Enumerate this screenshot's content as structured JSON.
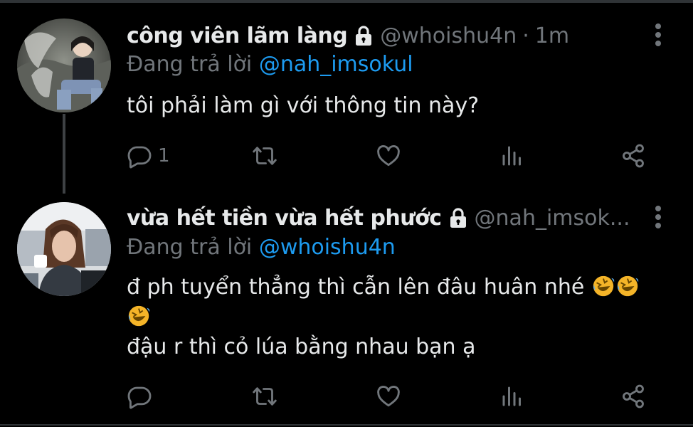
{
  "colors": {
    "background": "#000000",
    "text": "#e7e9ea",
    "secondary_text": "#71767b",
    "link": "#1d9bf0",
    "divider": "#2f3336"
  },
  "tweets": [
    {
      "display_name": "công viên lãm làng",
      "handle": "@whoishu4n",
      "separator": "·",
      "time": "1m",
      "protected_icon": "lock-icon",
      "replying_prefix": "Đang trả lời",
      "replying_to": "@nah_imsokul",
      "text_lines": [
        "tôi phải làm gì với thông tin này?"
      ],
      "reply_count": "1",
      "actions": [
        "reply-icon",
        "retweet-icon",
        "like-icon",
        "stats-icon",
        "share-icon"
      ]
    },
    {
      "display_name": "vừa hết tiền vừa hết phước",
      "handle": "@nah_imsok...",
      "protected_icon": "lock-icon",
      "replying_prefix": "Đang trả lời",
      "replying_to": "@whoishu4n",
      "text_lines": [
        "đ ph tuyển thẳng thì cẫn lên đâu huân nhé",
        "đậu r thì cỏ lúa bằng nhau bạn ạ"
      ],
      "emoji": "rolling-on-floor-laughing-emoji",
      "actions": [
        "reply-icon",
        "retweet-icon",
        "like-icon",
        "stats-icon",
        "share-icon"
      ]
    }
  ]
}
